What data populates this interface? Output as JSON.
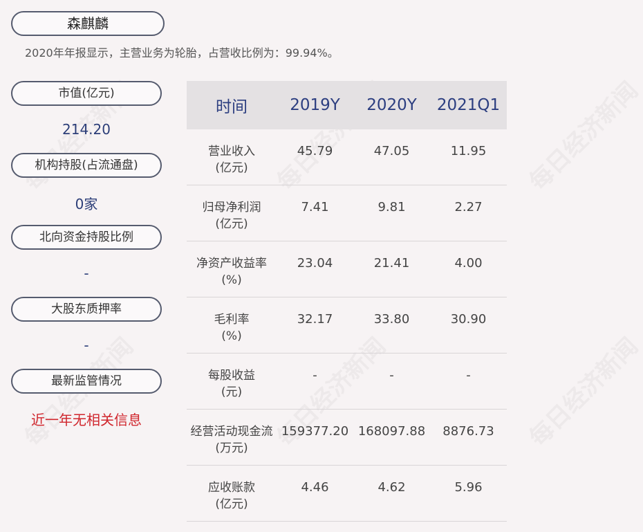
{
  "company": "森麒麟",
  "summary": "2020年年报显示，主营业务为轮胎，占营收比例为：99.94%。",
  "sidebar": {
    "market_cap_label": "市值(亿元)",
    "market_cap_value": "214.20",
    "institution_label": "机构持股(占流通盘)",
    "institution_value": "0家",
    "northbound_label": "北向资金持股比例",
    "northbound_value": "-",
    "pledge_label": "大股东质押率",
    "pledge_value": "-",
    "regulation_label": "最新监管情况",
    "regulation_value": "近一年无相关信息"
  },
  "table": {
    "headers": [
      "时间",
      "2019Y",
      "2020Y",
      "2021Q1"
    ],
    "rows": [
      {
        "label": "营业收入",
        "unit": "(亿元)",
        "values": [
          "45.79",
          "47.05",
          "11.95"
        ]
      },
      {
        "label": "归母净利润",
        "unit": "(亿元)",
        "values": [
          "7.41",
          "9.81",
          "2.27"
        ]
      },
      {
        "label": "净资产收益率",
        "unit": "(%)",
        "values": [
          "23.04",
          "21.41",
          "4.00"
        ]
      },
      {
        "label": "毛利率",
        "unit": "(%)",
        "values": [
          "32.17",
          "33.80",
          "30.90"
        ]
      },
      {
        "label": "每股收益",
        "unit": "(元)",
        "values": [
          "-",
          "-",
          "-"
        ]
      },
      {
        "label": "经营活动现金流",
        "unit": "(万元)",
        "values": [
          "159377.20",
          "168097.88",
          "8876.73"
        ]
      },
      {
        "label": "应收账款",
        "unit": "(亿元)",
        "values": [
          "4.46",
          "4.62",
          "5.96"
        ]
      }
    ]
  },
  "watermark": "每日经济新闻",
  "colors": {
    "background": "#f7f3f4",
    "header_text": "#2c3e80",
    "value_blue": "#2c3e78",
    "alert_red": "#d0262d"
  }
}
